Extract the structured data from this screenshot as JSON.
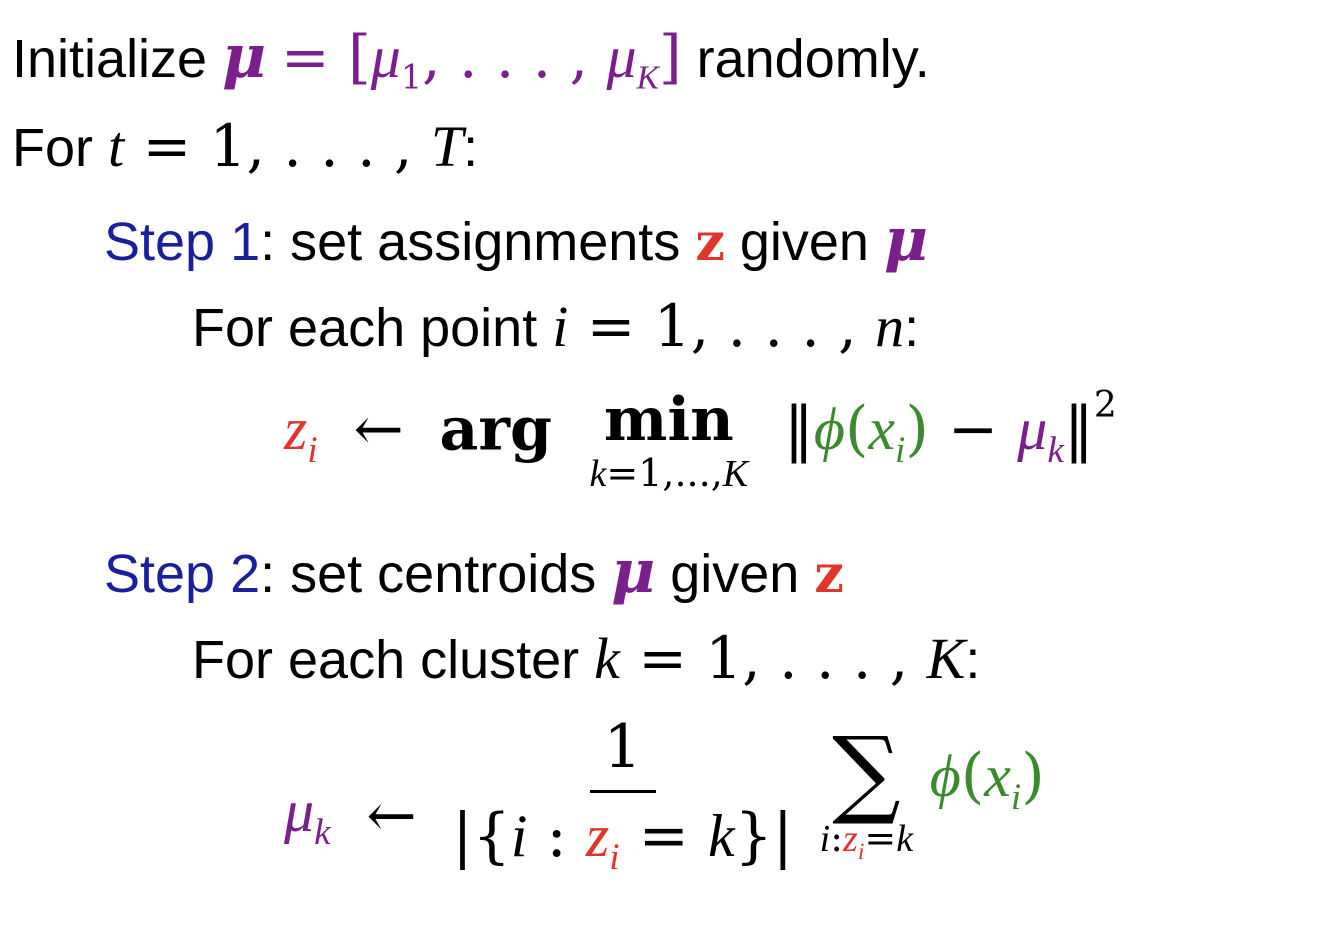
{
  "algorithm": {
    "init": {
      "prefix": "Initialize",
      "suffix": "randomly."
    },
    "loop": {
      "prefix": "For",
      "colon": ":"
    },
    "step1": {
      "label": "Step 1",
      "text_a": ": set assignments",
      "text_b": "given"
    },
    "step1_inner": {
      "text": "For each point",
      "colon": ":"
    },
    "step2": {
      "label": "Step 2",
      "text_a": ": set centroids",
      "text_b": "given"
    },
    "step2_inner": {
      "text": "For each cluster",
      "colon": ":"
    }
  },
  "colors": {
    "mu": "#7a1f8c",
    "z": "#e0352b",
    "phi": "#3c8a2e",
    "step_label": "#1a1f9c"
  }
}
